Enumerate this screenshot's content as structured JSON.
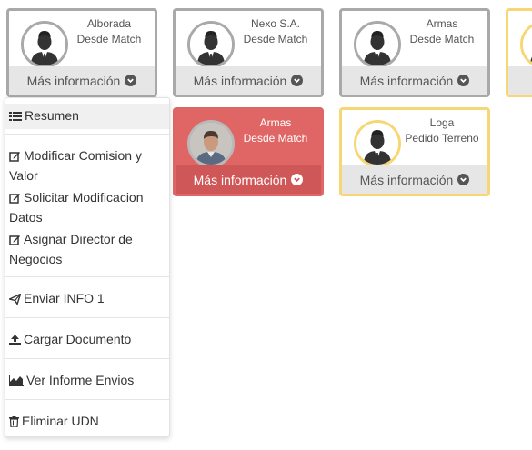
{
  "cards": [
    {
      "name": "Alborada",
      "status": "Desde Match",
      "more_label": "Más información",
      "style": "grey",
      "avatar": "user-silhouette-icon"
    },
    {
      "name": "Nexo S.A.",
      "status": "Desde Match",
      "more_label": "Más información",
      "style": "grey",
      "avatar": "user-silhouette-icon"
    },
    {
      "name": "Armas",
      "status": "Desde Match",
      "more_label": "Más información",
      "style": "grey",
      "avatar": "user-silhouette-icon"
    },
    {
      "name": "Armas",
      "status": "Desde Match",
      "more_label": "Más información",
      "style": "red",
      "avatar": "user-photo"
    },
    {
      "name": "Loga",
      "status": "Pedido Terreno",
      "more_label": "Más información",
      "style": "yellow",
      "avatar": "user-silhouette-icon"
    },
    {
      "name": "",
      "status": "",
      "more_label": "",
      "style": "yellow",
      "avatar": "user-silhouette-icon"
    }
  ],
  "menu": {
    "items": [
      {
        "label": "Resumen",
        "icon": "list-icon"
      },
      {
        "label": "Modificar Comision y Valor",
        "icon": "edit-icon"
      },
      {
        "label": "Solicitar Modificacion Datos",
        "icon": "edit-icon"
      },
      {
        "label": "Asignar Director de Negocios",
        "icon": "edit-icon"
      },
      {
        "label": "Enviar INFO 1",
        "icon": "send-icon"
      },
      {
        "label": "Cargar Documento",
        "icon": "upload-icon"
      },
      {
        "label": "Ver Informe Envios",
        "icon": "area-chart-icon"
      },
      {
        "label": "Eliminar UDN",
        "icon": "trash-icon"
      }
    ]
  },
  "colors": {
    "card_border_grey": "#a9a9a9",
    "card_border_yellow": "#f7d774",
    "card_active_red": "#e06666",
    "footer_grey": "#e6e6e6"
  }
}
